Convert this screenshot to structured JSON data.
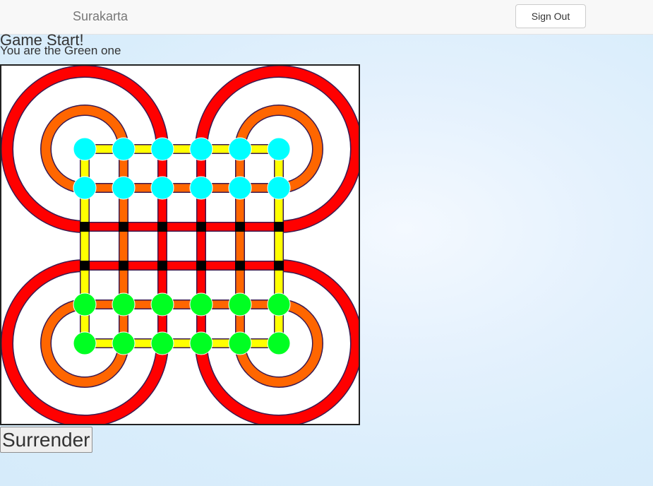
{
  "navbar": {
    "brand": "Surakarta",
    "sign_out_label": "Sign Out"
  },
  "game": {
    "status": "Game Start!",
    "player_info": "You are the Green one",
    "surrender_label": "Surrender",
    "board_size": 6,
    "colors": {
      "outer_loop": "#ff0000",
      "inner_loop": "#ff6600",
      "grid_outline": "#ffff00",
      "intersection": "#000000",
      "opponent_piece": "#00ffff",
      "player_piece": "#00ff22"
    },
    "pieces": {
      "cyan": [
        [
          0,
          0
        ],
        [
          0,
          1
        ],
        [
          0,
          2
        ],
        [
          0,
          3
        ],
        [
          0,
          4
        ],
        [
          0,
          5
        ],
        [
          1,
          0
        ],
        [
          1,
          1
        ],
        [
          1,
          2
        ],
        [
          1,
          3
        ],
        [
          1,
          4
        ],
        [
          1,
          5
        ]
      ],
      "green": [
        [
          4,
          0
        ],
        [
          4,
          1
        ],
        [
          4,
          2
        ],
        [
          4,
          3
        ],
        [
          4,
          4
        ],
        [
          4,
          5
        ],
        [
          5,
          0
        ],
        [
          5,
          1
        ],
        [
          5,
          2
        ],
        [
          5,
          3
        ],
        [
          5,
          4
        ],
        [
          5,
          5
        ]
      ]
    }
  }
}
